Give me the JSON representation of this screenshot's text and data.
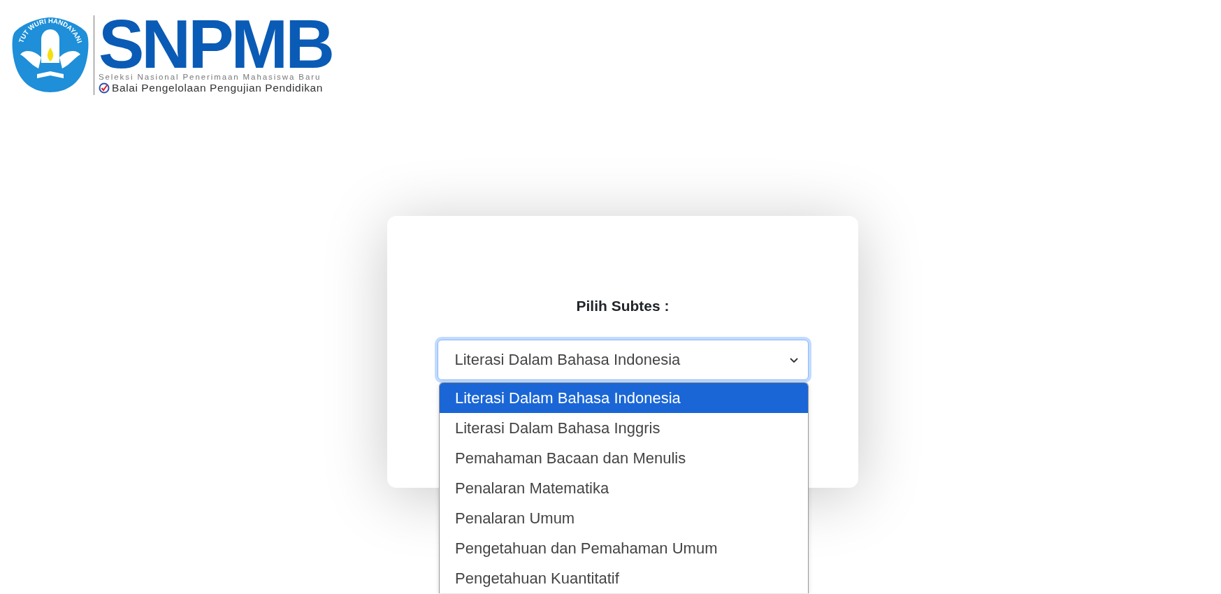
{
  "logo": {
    "motto": "TUT WURI HANDAYANI",
    "wordmark": "SNPMB",
    "tagline": "Seleksi Nasional Penerimaan Mahasiswa Baru",
    "agency": "Balai Pengelolaan Pengujian Pendidikan"
  },
  "form": {
    "label": "Pilih Subtes :",
    "select": {
      "value": "Literasi Dalam Bahasa Indonesia",
      "expanded": true,
      "options": [
        {
          "label": "Literasi Dalam Bahasa Indonesia",
          "selected": true
        },
        {
          "label": "Literasi Dalam Bahasa Inggris",
          "selected": false
        },
        {
          "label": "Pemahaman Bacaan dan Menulis",
          "selected": false
        },
        {
          "label": "Penalaran Matematika",
          "selected": false
        },
        {
          "label": "Penalaran Umum",
          "selected": false
        },
        {
          "label": "Pengetahuan dan Pemahaman Umum",
          "selected": false
        },
        {
          "label": "Pengetahuan Kuantitatif",
          "selected": false
        }
      ]
    }
  }
}
